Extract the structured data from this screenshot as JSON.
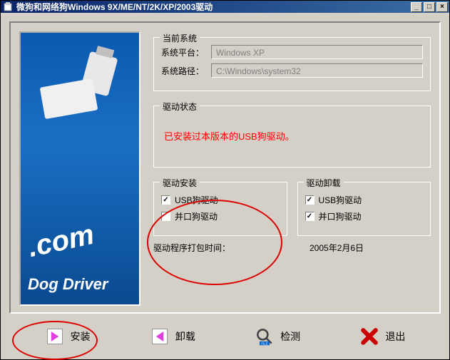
{
  "titlebar": {
    "title": "微狗和网络狗Windows 9X/ME/NT/2K/XP/2003驱动"
  },
  "sidebar": {
    "com_text": ".com",
    "brand_text": "Dog Driver"
  },
  "system_info": {
    "legend": "当前系统",
    "platform_label": "系统平台：",
    "platform_value": "Windows XP",
    "path_label": "系统路径：",
    "path_value": "C:\\Windows\\system32"
  },
  "driver_status": {
    "legend": "驱动状态",
    "message": "已安装过本版本的USB狗驱动。"
  },
  "install": {
    "legend": "驱动安装",
    "usb_label": "USB狗驱动",
    "usb_checked": true,
    "parallel_label": "并口狗驱动",
    "parallel_checked": false
  },
  "uninstall": {
    "legend": "驱动卸载",
    "usb_label": "USB狗驱动",
    "usb_checked": true,
    "parallel_label": "并口狗驱动",
    "parallel_checked": true
  },
  "package_date": {
    "label": "驱动程序打包时间：",
    "value": "2005年2月6日"
  },
  "buttons": {
    "install": "安装",
    "uninstall": "卸载",
    "detect": "检测",
    "exit": "退出"
  }
}
